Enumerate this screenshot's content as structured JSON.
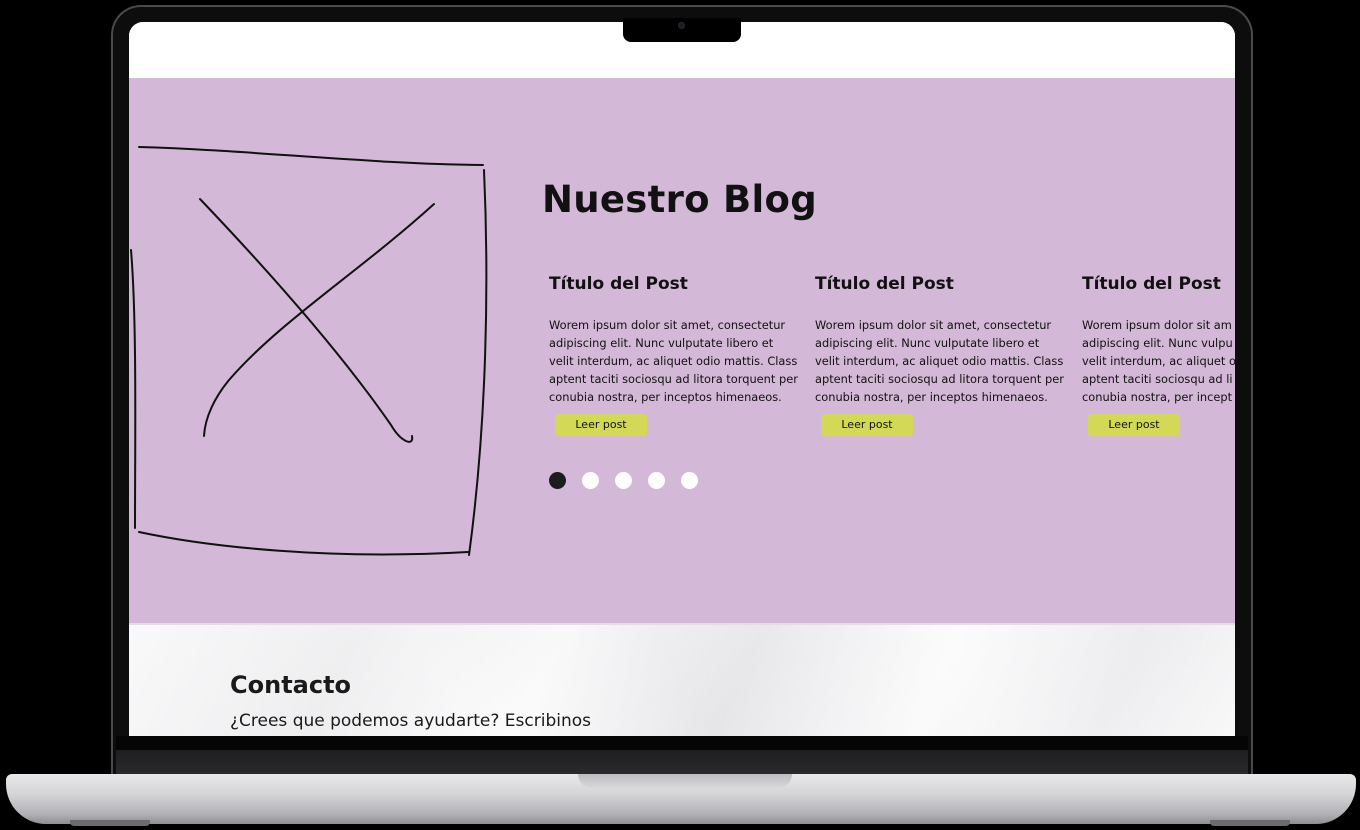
{
  "blog": {
    "title": "Nuestro Blog",
    "image_icon": "crossed-box-placeholder-icon",
    "background_color": "#d4b8d7",
    "posts": [
      {
        "title": "Título del Post",
        "excerpt_lines": [
          "Worem ipsum dolor sit amet, consectetur",
          "adipiscing elit. Nunc vulputate libero et",
          "velit interdum, ac aliquet odio mattis. Class",
          "aptent taciti sociosqu ad litora torquent per",
          "conubia nostra, per inceptos himenaeos."
        ],
        "button_label": "Leer post"
      },
      {
        "title": "Título del Post",
        "excerpt_lines": [
          "Worem ipsum dolor sit amet, consectetur",
          "adipiscing elit. Nunc vulputate libero et",
          "velit interdum, ac aliquet odio mattis. Class",
          "aptent taciti sociosqu ad litora torquent per",
          "conubia nostra, per inceptos himenaeos."
        ],
        "button_label": "Leer post"
      },
      {
        "title": "Título del Post",
        "excerpt_lines": [
          "Worem ipsum dolor sit am",
          "adipiscing elit. Nunc vulpu",
          "velit interdum, ac aliquet o",
          "aptent taciti sociosqu ad li",
          "conubia nostra, per incept"
        ],
        "button_label": "Leer post"
      }
    ],
    "button_color": "#d3d956",
    "carousel": {
      "total": 5,
      "active_index": 0
    }
  },
  "contact": {
    "title": "Contacto",
    "subtitle": "¿Crees que podemos ayudarte? Escribinos"
  }
}
